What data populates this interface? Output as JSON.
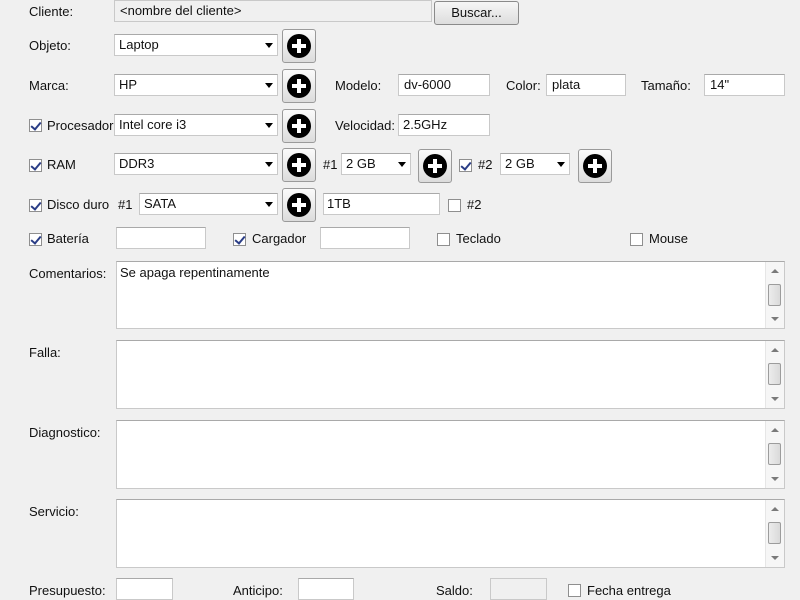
{
  "cliente": {
    "label": "Cliente:",
    "value": "<nombre del cliente>",
    "buscar": "Buscar..."
  },
  "objeto": {
    "label": "Objeto:",
    "value": "Laptop"
  },
  "marca": {
    "label": "Marca:",
    "value": "HP"
  },
  "modelo": {
    "label": "Modelo:",
    "value": "dv-6000"
  },
  "color": {
    "label": "Color:",
    "value": "plata"
  },
  "tamano": {
    "label": "Tamaño:",
    "value": "14\""
  },
  "procesador": {
    "label": "Procesador",
    "checked": true,
    "value": "Intel core i3"
  },
  "velocidad": {
    "label": "Velocidad:",
    "value": "2.5GHz"
  },
  "ram": {
    "label": "RAM",
    "checked": true,
    "type": "DDR3",
    "slot1": {
      "label": "#1",
      "value": "2 GB"
    },
    "slot2": {
      "label": "#2",
      "value": "2 GB",
      "checked": true
    }
  },
  "disco": {
    "label": "Disco duro",
    "checked": true,
    "slot1": {
      "label": "#1",
      "type": "SATA",
      "size": "1TB"
    },
    "slot2": {
      "label": "#2",
      "checked": false
    }
  },
  "bateria": {
    "label": "Batería",
    "checked": true,
    "value": ""
  },
  "cargador": {
    "label": "Cargador",
    "checked": true,
    "value": ""
  },
  "teclado": {
    "label": "Teclado",
    "checked": false
  },
  "mouse": {
    "label": "Mouse",
    "checked": false
  },
  "comentarios": {
    "label": "Comentarios:",
    "value": "Se apaga repentinamente"
  },
  "falla": {
    "label": "Falla:",
    "value": ""
  },
  "diagnostico": {
    "label": "Diagnostico:",
    "value": ""
  },
  "servicio": {
    "label": "Servicio:",
    "value": ""
  },
  "presupuesto": {
    "label": "Presupuesto:",
    "value": ""
  },
  "anticipo": {
    "label": "Anticipo:",
    "value": ""
  },
  "saldo": {
    "label": "Saldo:",
    "value": ""
  },
  "fecha_entrega": {
    "label": "Fecha entrega",
    "checked": false
  }
}
